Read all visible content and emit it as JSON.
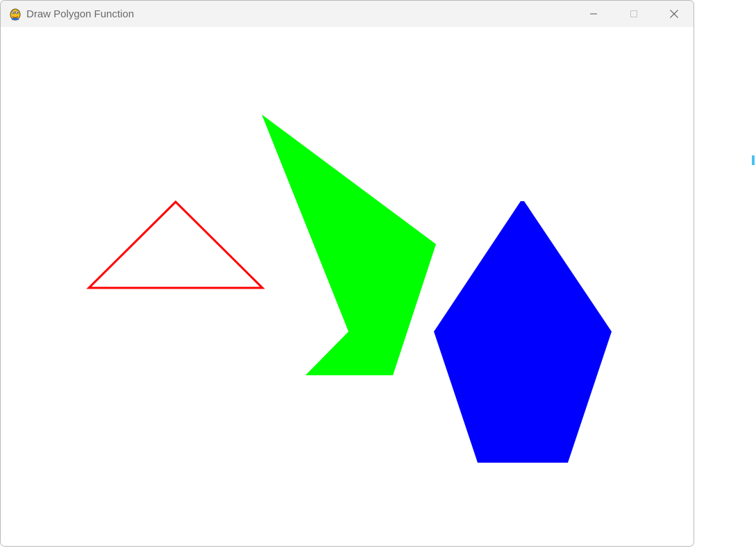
{
  "window": {
    "title": "Draw Polygon Function",
    "app_icon": "pygame-snake-icon",
    "controls": {
      "minimize_icon": "minimize-icon",
      "maximize_icon": "maximize-icon",
      "close_icon": "close-icon"
    }
  },
  "canvas": {
    "background": "#ffffff",
    "shapes": [
      {
        "name": "triangle",
        "style": "outline",
        "color": "#ff0000"
      },
      {
        "name": "concave-polygon",
        "style": "filled",
        "color": "#00ff00"
      },
      {
        "name": "pentagon",
        "style": "filled",
        "color": "#0000ff"
      }
    ]
  }
}
